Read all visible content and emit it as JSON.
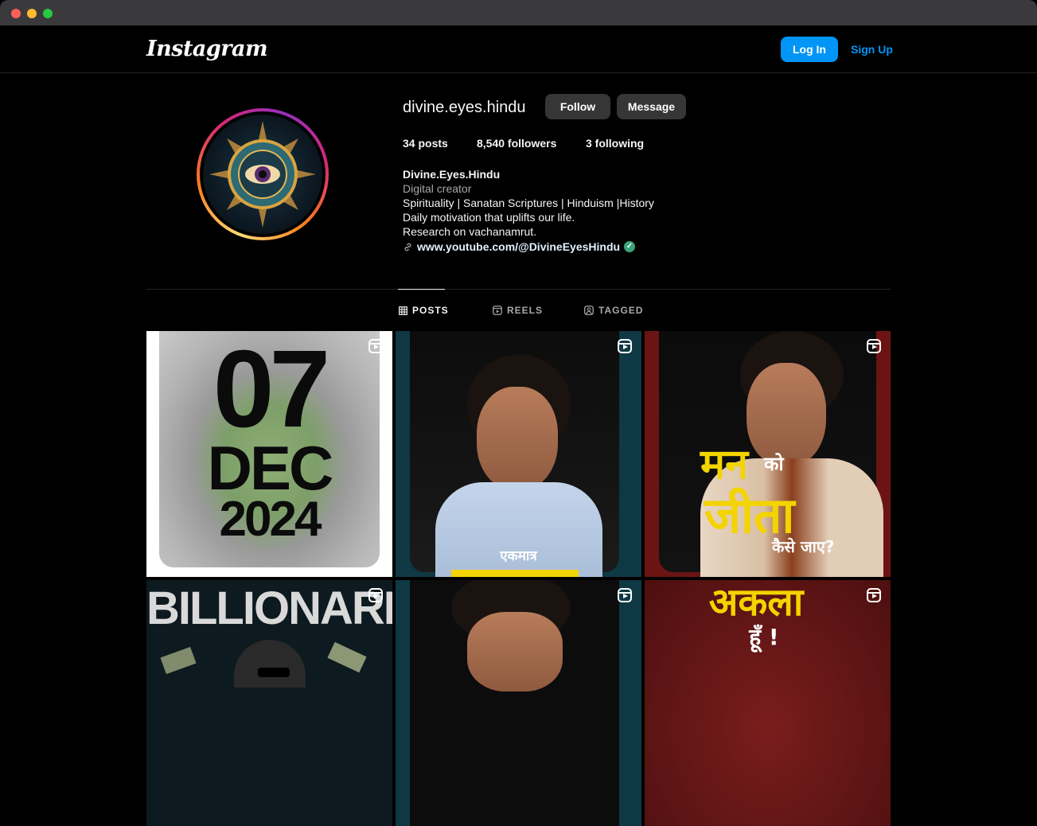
{
  "window": {
    "controls": [
      "close",
      "minimize",
      "maximize"
    ]
  },
  "nav": {
    "logo": "Instagram",
    "login_label": "Log In",
    "signup_label": "Sign Up"
  },
  "profile": {
    "username": "divine.eyes.hindu",
    "follow_label": "Follow",
    "message_label": "Message",
    "posts": "34 posts",
    "followers": "8,540 followers",
    "following": "3 following",
    "display_name": "Divine.Eyes.Hindu",
    "category": "Digital creator",
    "bio_line1": "Spirituality | Sanatan Scriptures | Hinduism |History",
    "bio_line2": "Daily motivation that uplifts our life.",
    "bio_line3": "Research on vachanamrut.",
    "link": "www.youtube.com/@DivineEyesHindu"
  },
  "tabs": [
    {
      "label": "POSTS",
      "icon": "grid-icon",
      "active": true
    },
    {
      "label": "REELS",
      "icon": "reels-icon",
      "active": false
    },
    {
      "label": "TAGGED",
      "icon": "tagged-icon",
      "active": false
    }
  ],
  "posts": [
    {
      "line1": "07",
      "line2": "DEC",
      "line3": "2024"
    },
    {
      "caption": "एकमात्र"
    },
    {
      "line1": "मन",
      "line2": "को",
      "line3": "जीता",
      "line4": "कैसे जाए?"
    },
    {
      "caption": "BILLIONARE"
    },
    {
      "caption": ""
    },
    {
      "line1": "अकला",
      "line2": "हूँ !"
    }
  ],
  "colors": {
    "accent": "#0095f6",
    "button_bg": "#363636",
    "verified": "#3aa37a"
  }
}
